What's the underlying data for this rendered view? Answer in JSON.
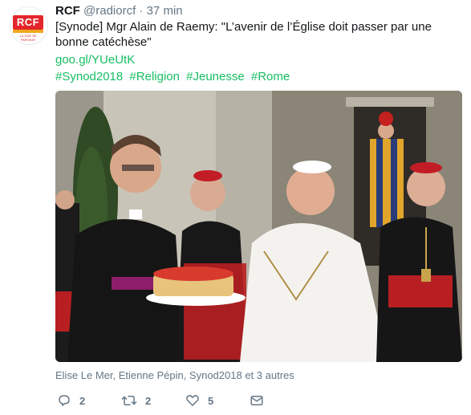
{
  "tweet": {
    "author_name": "RCF",
    "author_handle": "@radiorcf",
    "separator": "·",
    "time": "37 min",
    "avatar": {
      "logo_text": "RCF",
      "tagline": "LA JOIE SE PARTAGE"
    },
    "text": "[Synode] Mgr Alain de Raemy: \"L’avenir de l’Église doit passer par une bonne catéchèse\"",
    "link": "goo.gl/YUeUtK",
    "hashtags": [
      "#Synod2018",
      "#Religion",
      "#Jeunesse",
      "#Rome"
    ],
    "tagged": "Elise Le Mer, Etienne Pépin, Synod2018 et 3 autres",
    "actions": {
      "reply_count": "2",
      "retweet_count": "2",
      "like_count": "5"
    }
  },
  "colors": {
    "accent": "#17bf63",
    "muted": "#657786",
    "brand_red": "#e3262c"
  },
  "icons": [
    "reply-icon",
    "retweet-icon",
    "like-icon",
    "message-icon"
  ]
}
